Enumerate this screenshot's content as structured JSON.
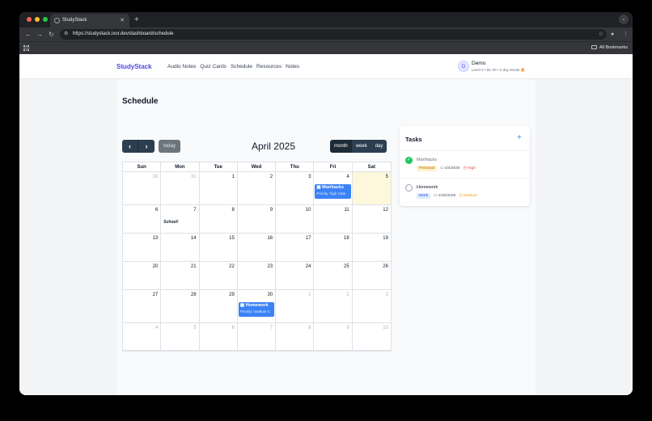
{
  "browser": {
    "tab_title": "StudyStack",
    "url": "https://studystack.ixor.dev/dashboard/schedule",
    "bookmarks_label": "All Bookmarks"
  },
  "app": {
    "brand": "StudyStack",
    "nav": [
      "Audio Notes",
      "Quiz Cards",
      "Schedule",
      "Resources",
      "Notes"
    ],
    "user": {
      "initial": "D",
      "name": "Demo",
      "stats": "Level 3 • 56 XP • 0 day streak",
      "streak_icon": "🔥"
    }
  },
  "schedule": {
    "title": "Schedule",
    "today_label": "today",
    "month_title": "April 2025",
    "views": [
      "month",
      "week",
      "day"
    ],
    "weekdays": [
      "Sun",
      "Mon",
      "Tue",
      "Wed",
      "Thu",
      "Fri",
      "Sat"
    ],
    "days": [
      {
        "n": "30",
        "other": true
      },
      {
        "n": "31",
        "other": true
      },
      {
        "n": "1"
      },
      {
        "n": "2"
      },
      {
        "n": "3"
      },
      {
        "n": "4",
        "event": {
          "title": "Marihacks",
          "sub": "Priority: high Cate"
        }
      },
      {
        "n": "5",
        "today": true
      },
      {
        "n": "6"
      },
      {
        "n": "7",
        "label": "School!"
      },
      {
        "n": "8"
      },
      {
        "n": "9"
      },
      {
        "n": "10"
      },
      {
        "n": "11"
      },
      {
        "n": "12"
      },
      {
        "n": "13"
      },
      {
        "n": "14"
      },
      {
        "n": "15"
      },
      {
        "n": "16"
      },
      {
        "n": "17"
      },
      {
        "n": "18"
      },
      {
        "n": "19"
      },
      {
        "n": "20"
      },
      {
        "n": "21"
      },
      {
        "n": "22"
      },
      {
        "n": "23"
      },
      {
        "n": "24"
      },
      {
        "n": "25"
      },
      {
        "n": "26"
      },
      {
        "n": "27"
      },
      {
        "n": "28"
      },
      {
        "n": "29"
      },
      {
        "n": "30",
        "event": {
          "title": "Homework",
          "sub": "Priority: medium C"
        }
      },
      {
        "n": "1",
        "other": true
      },
      {
        "n": "2",
        "other": true
      },
      {
        "n": "3",
        "other": true
      },
      {
        "n": "4",
        "other": true
      },
      {
        "n": "5",
        "other": true
      },
      {
        "n": "6",
        "other": true
      },
      {
        "n": "7",
        "other": true
      },
      {
        "n": "8",
        "other": true
      },
      {
        "n": "9",
        "other": true
      },
      {
        "n": "10",
        "other": true
      }
    ]
  },
  "tasks": {
    "title": "Tasks",
    "add_icon": "+",
    "items": [
      {
        "name": "Marihacks",
        "done": true,
        "category": "Personal",
        "date": "4/4/2025",
        "priority": "High"
      },
      {
        "name": "Homework",
        "done": false,
        "category": "Work",
        "date": "4/30/2025",
        "priority": "Medium"
      }
    ]
  },
  "colors": {
    "brand": "#4f46e5",
    "event": "#3b82f6",
    "today_bg": "#fdf8dc",
    "toolbar_btn": "#2c3e50"
  }
}
